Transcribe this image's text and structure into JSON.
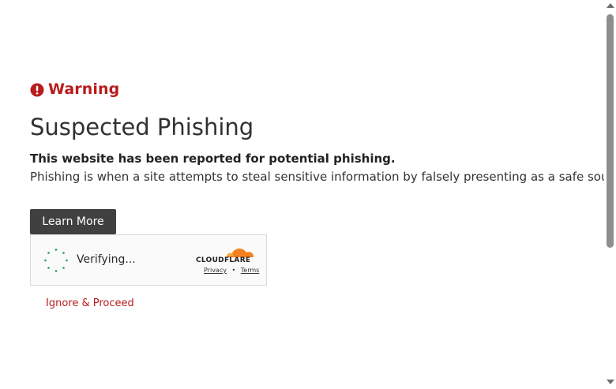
{
  "warning": {
    "icon": "exclamation-circle-icon",
    "label": "Warning",
    "color": "#b91c1c"
  },
  "title": "Suspected Phishing",
  "message": {
    "bold": "This website has been reported for potential phishing.",
    "description": "Phishing is when a site attempts to steal sensitive information by falsely presenting as a safe source."
  },
  "learn_more": {
    "label": "Learn More"
  },
  "turnstile": {
    "status": "Verifying...",
    "brand": "CLOUDFLARE",
    "brand_color": "#f48120",
    "privacy_label": "Privacy",
    "separator": "•",
    "terms_label": "Terms",
    "spinner_icon": "loading-spinner-icon"
  },
  "ignore": {
    "label": "Ignore & Proceed"
  }
}
